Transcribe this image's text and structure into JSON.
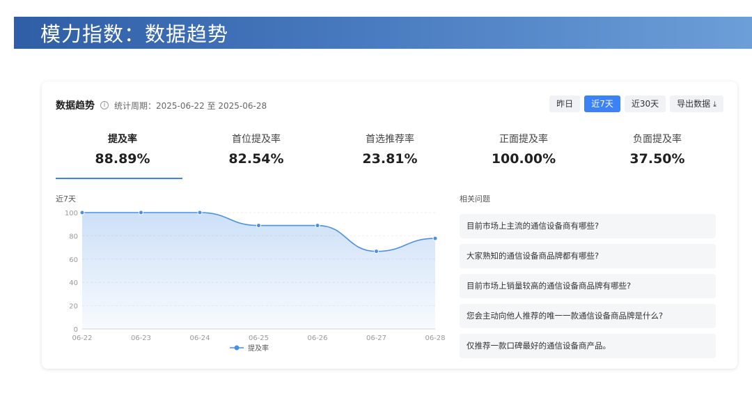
{
  "banner": {
    "title": "模力指数：数据趋势"
  },
  "card": {
    "title": "数据趋势",
    "info_icon": "info-icon",
    "period": "统计周期：2025-06-22 至 2025-06-28",
    "buttons": {
      "yesterday": "昨日",
      "last7": "近7天",
      "last30": "近30天",
      "export": "导出数据",
      "export_icon": "download-icon",
      "active": "last7"
    }
  },
  "metrics": [
    {
      "label": "提及率",
      "value": "88.89%",
      "active": true
    },
    {
      "label": "首位提及率",
      "value": "82.54%",
      "active": false
    },
    {
      "label": "首选推荐率",
      "value": "23.81%",
      "active": false
    },
    {
      "label": "正面提及率",
      "value": "100.00%",
      "active": false
    },
    {
      "label": "负面提及率",
      "value": "37.50%",
      "active": false
    }
  ],
  "chart_label": "近7天",
  "chart_data": {
    "type": "area",
    "categories": [
      "06-22",
      "06-23",
      "06-24",
      "06-25",
      "06-26",
      "06-27",
      "06-28"
    ],
    "series": [
      {
        "name": "提及率",
        "values": [
          100,
          100,
          100,
          88.89,
          88.89,
          66.67,
          77.78
        ]
      }
    ],
    "ylim": [
      0,
      100
    ],
    "yticks": [
      0,
      20,
      40,
      60,
      80,
      100
    ],
    "legend": "bottom-center",
    "grid": true,
    "color": "#4a90e2"
  },
  "questions": {
    "header": "相关问题",
    "items": [
      "目前市场上主流的通信设备商有哪些?",
      "大家熟知的通信设备商品牌都有哪些?",
      "目前市场上销量较高的通信设备商品牌有哪些?",
      "您会主动向他人推荐的唯一一款通信设备商品牌是什么?",
      "仅推荐一款口碑最好的通信设备商产品。"
    ]
  }
}
